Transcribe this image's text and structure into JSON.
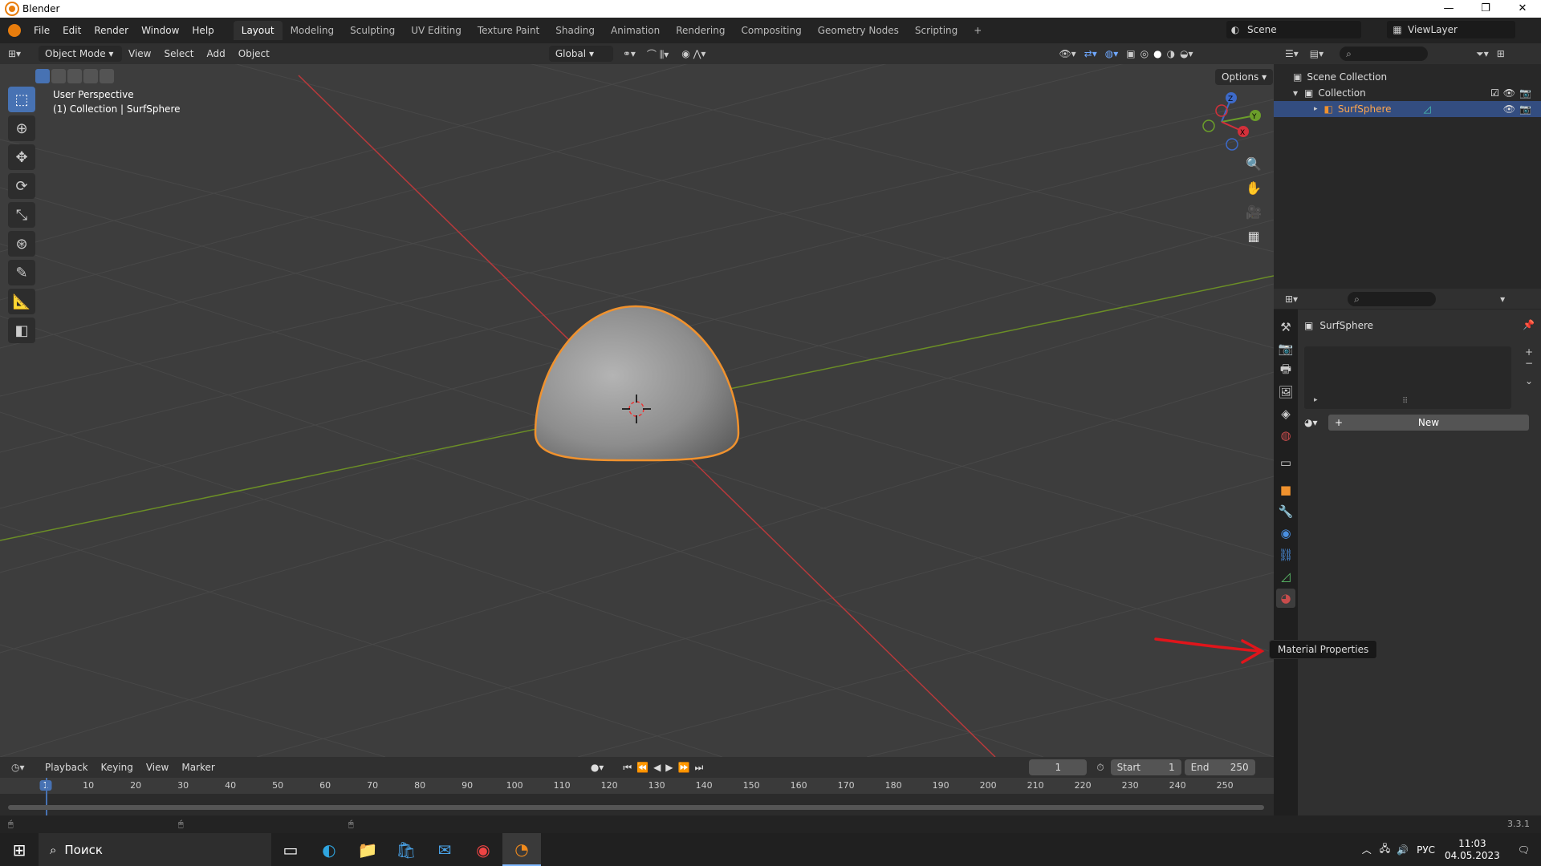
{
  "titlebar": {
    "title": "Blender",
    "min": "—",
    "max": "❐",
    "close": "✕"
  },
  "menu": [
    "File",
    "Edit",
    "Render",
    "Window",
    "Help"
  ],
  "workspaces": [
    {
      "label": "Layout",
      "active": true
    },
    {
      "label": "Modeling"
    },
    {
      "label": "Sculpting"
    },
    {
      "label": "UV Editing"
    },
    {
      "label": "Texture Paint"
    },
    {
      "label": "Shading"
    },
    {
      "label": "Animation"
    },
    {
      "label": "Rendering"
    },
    {
      "label": "Compositing"
    },
    {
      "label": "Geometry Nodes"
    },
    {
      "label": "Scripting"
    },
    {
      "label": "+"
    }
  ],
  "scene": "Scene",
  "viewlayer": "ViewLayer",
  "viewport": {
    "mode": "Object Mode",
    "menus": [
      "View",
      "Select",
      "Add",
      "Object"
    ],
    "orientation": "Global",
    "options": "Options",
    "overlay_line1": "User Perspective",
    "overlay_line2": "(1) Collection | SurfSphere",
    "gizmo": {
      "z": "Z",
      "y": "Y",
      "x": "X"
    }
  },
  "outliner": {
    "scene_collection": "Scene Collection",
    "collection": "Collection",
    "object": "SurfSphere"
  },
  "properties": {
    "object_name": "SurfSphere",
    "new_button": "New",
    "plus": "+",
    "tooltip": "Material Properties"
  },
  "timeline": {
    "menus": [
      "Playback",
      "Keying",
      "View",
      "Marker"
    ],
    "current_frame": "1",
    "start_label": "Start",
    "start": "1",
    "end_label": "End",
    "end": "250",
    "ticks": [
      "1",
      "10",
      "20",
      "30",
      "40",
      "50",
      "60",
      "70",
      "80",
      "90",
      "100",
      "110",
      "120",
      "130",
      "140",
      "150",
      "160",
      "170",
      "180",
      "190",
      "200",
      "210",
      "220",
      "230",
      "240",
      "250"
    ]
  },
  "status": {
    "version": "3.3.1"
  },
  "taskbar": {
    "search": "Поиск",
    "lang": "РУС",
    "time": "11:03",
    "date": "04.05.2023"
  },
  "colors": {
    "accent": "#4772b3",
    "selected_outline": "#f0922e",
    "axis_x": "#c0393b",
    "axis_y": "#6a8f2a",
    "annotation": "#e0151b"
  }
}
